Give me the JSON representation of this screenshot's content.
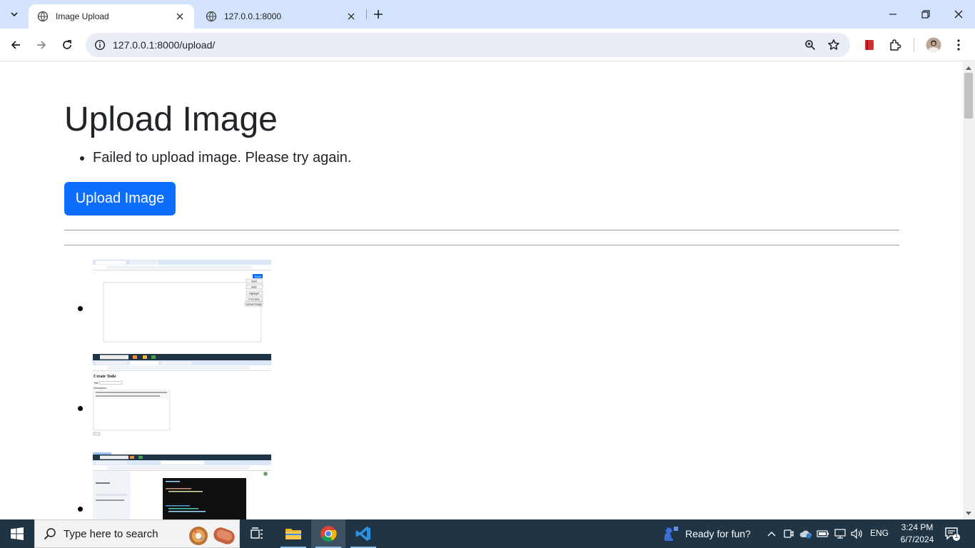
{
  "browser": {
    "tabs": [
      {
        "title": "Image Upload",
        "active": true
      },
      {
        "title": "127.0.0.1:8000",
        "active": false
      }
    ],
    "url": "127.0.0.1:8000/upload/"
  },
  "page": {
    "title": "Upload Image",
    "errors": [
      "Failed to upload image. Please try again."
    ],
    "upload_button_label": "Upload Image",
    "accent_color": "#0d6efd",
    "images": [
      {
        "description_text_items": [
          "Tools",
          "Bold",
          "Italic",
          "Highlight",
          "Font Size",
          "Upload Image"
        ]
      },
      {
        "heading": "Create Todo",
        "fields": [
          "Title",
          "Description"
        ]
      },
      {
        "dark_panel": true
      }
    ]
  },
  "taskbar": {
    "search_placeholder": "Type here to search",
    "weather_text": "Ready for fun?",
    "language": "ENG",
    "time": "3:24 PM",
    "date": "6/7/2024",
    "notification_count": "1"
  }
}
